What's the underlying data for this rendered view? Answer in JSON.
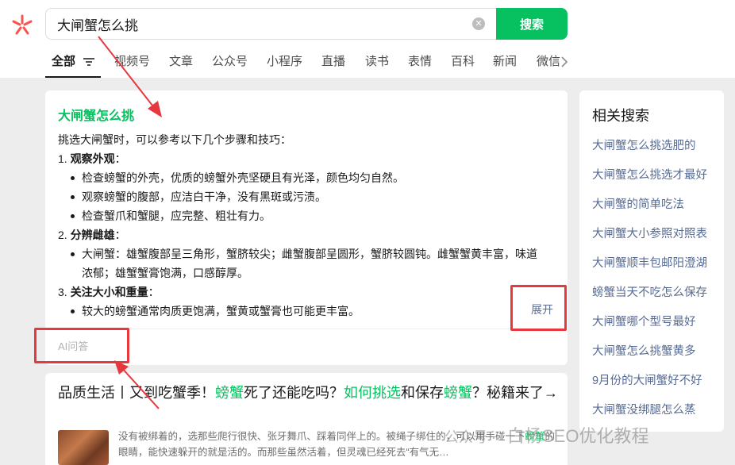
{
  "search": {
    "query": "大闸蟹怎么挑",
    "button_label": "搜索"
  },
  "tabs": [
    {
      "label": "全部"
    },
    {
      "label": "视频号"
    },
    {
      "label": "文章"
    },
    {
      "label": "公众号"
    },
    {
      "label": "小程序"
    },
    {
      "label": "直播"
    },
    {
      "label": "读书"
    },
    {
      "label": "表情"
    },
    {
      "label": "百科"
    },
    {
      "label": "新闻"
    },
    {
      "label": "微信"
    }
  ],
  "ai_answer": {
    "title": "大闸蟹怎么挑",
    "intro": "挑选大闸蟹时，可以参考以下几个步骤和技巧：",
    "sections": [
      {
        "num": "1. ",
        "heading": "观察外观",
        "colon": "：",
        "bullets": [
          "检查螃蟹的外壳，优质的螃蟹外壳坚硬且有光泽，颜色均匀自然。",
          "观察螃蟹的腹部，应洁白干净，没有黑斑或污渍。",
          "检查蟹爪和蟹腿，应完整、粗壮有力。"
        ]
      },
      {
        "num": "2. ",
        "heading": "分辨雌雄",
        "colon": "：",
        "bullets": [
          "大闸蟹：雄蟹腹部呈三角形，蟹脐较尖；雌蟹腹部呈圆形，蟹脐较圆钝。雌蟹蟹黄丰富，味道浓郁；雄蟹蟹膏饱满，口感醇厚。"
        ]
      },
      {
        "num": "3. ",
        "heading": "关注大小和重量",
        "colon": "：",
        "bullets": [
          "较大的螃蟹通常肉质更饱满，蟹黄或蟹膏也可能更丰富。"
        ]
      }
    ],
    "expand_label": "展开",
    "source_label": "AI问答"
  },
  "article": {
    "title_parts": [
      "品质生活丨又到吃蟹季！",
      "螃蟹",
      "死了还能吃吗？",
      "如何挑选",
      "和保存",
      "螃蟹",
      "？秘籍来了→"
    ],
    "snippet_parts": [
      "没有被绑着的，选那些爬行很快、张牙舞爪、踩着同伴上的。被绳子绑住的，可以用手碰一下",
      "螃蟹",
      "的眼睛，能快速躲开的就是活的。而那些虽然活着，但灵魂已经死去“有气无…"
    ]
  },
  "related": {
    "title": "相关搜索",
    "items": [
      "大闸蟹怎么挑选肥的",
      "大闸蟹怎么挑选才最好",
      "大闸蟹的简单吃法",
      "大闸蟹大小参照对照表",
      "大闸蟹顺丰包邮阳澄湖",
      "螃蟹当天不吃怎么保存",
      "大闸蟹哪个型号最好",
      "大闸蟹怎么挑蟹黄多",
      "9月份的大闸蟹好不好",
      "大闸蟹没绑腿怎么蒸"
    ]
  },
  "watermark": {
    "prefix": "公众号 ·",
    "name": "白杨SEO优化教程"
  },
  "colors": {
    "brand_green": "#07c160",
    "link_blue": "#576b95",
    "annotation_red": "#e6383d"
  },
  "icons": {
    "logo": "wechat-search-logo-icon",
    "clear": "clear-icon",
    "filter": "filter-icon",
    "next": "chevron-right-icon"
  }
}
